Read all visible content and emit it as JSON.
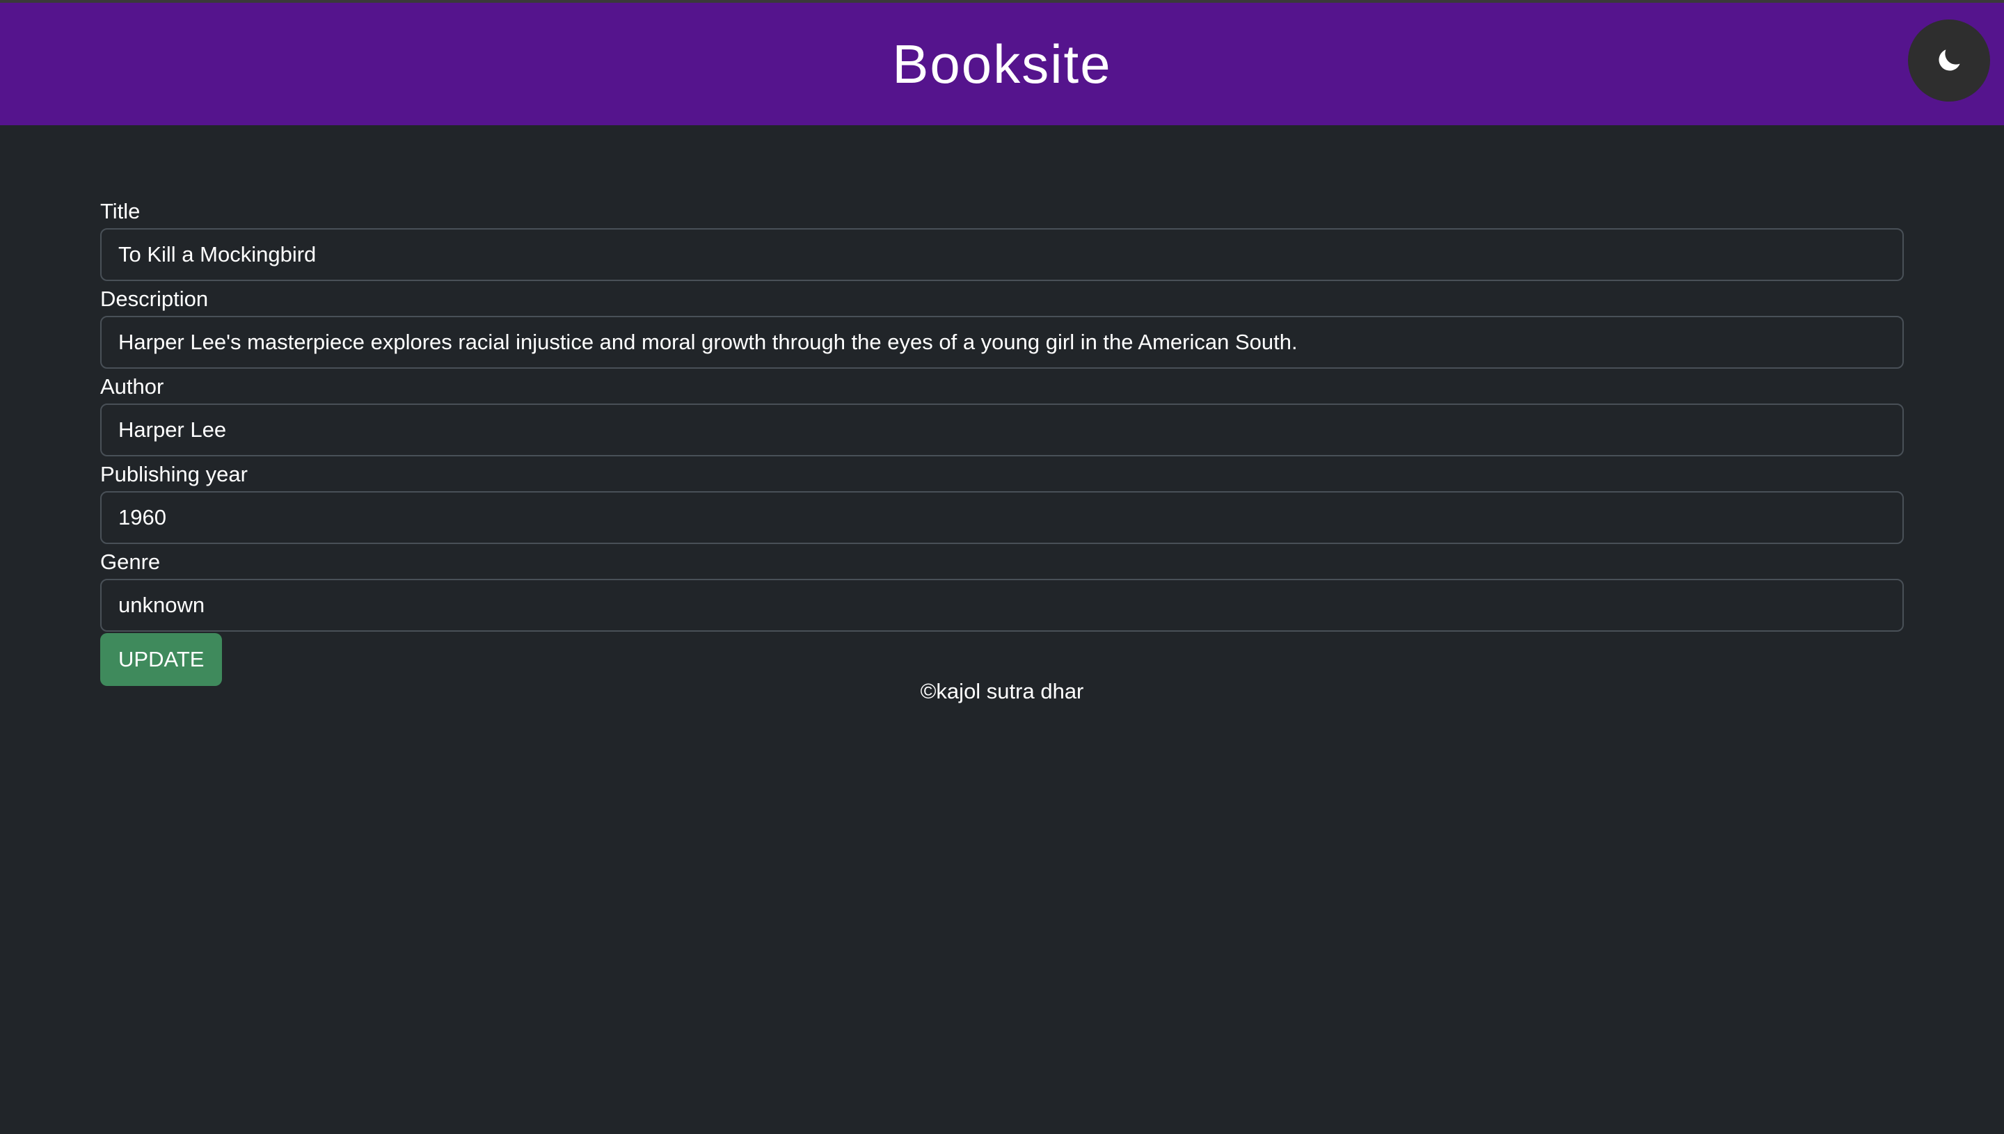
{
  "header": {
    "brand": "Booksite",
    "theme_toggle_icon": "moon-icon"
  },
  "colors": {
    "navbar": "#55148d",
    "background": "#212529",
    "button": "#3f8a5c"
  },
  "form": {
    "title": {
      "label": "Title",
      "value": "To Kill a Mockingbird"
    },
    "description": {
      "label": "Description",
      "value": "Harper Lee's masterpiece explores racial injustice and moral growth through the eyes of a young girl in the American South."
    },
    "author": {
      "label": "Author",
      "value": "Harper Lee"
    },
    "year": {
      "label": "Publishing year",
      "value": "1960"
    },
    "genre": {
      "label": "Genre",
      "value": "unknown"
    },
    "submit_label": "UPDATE"
  },
  "footer": {
    "text": "©kajol sutra dhar"
  }
}
